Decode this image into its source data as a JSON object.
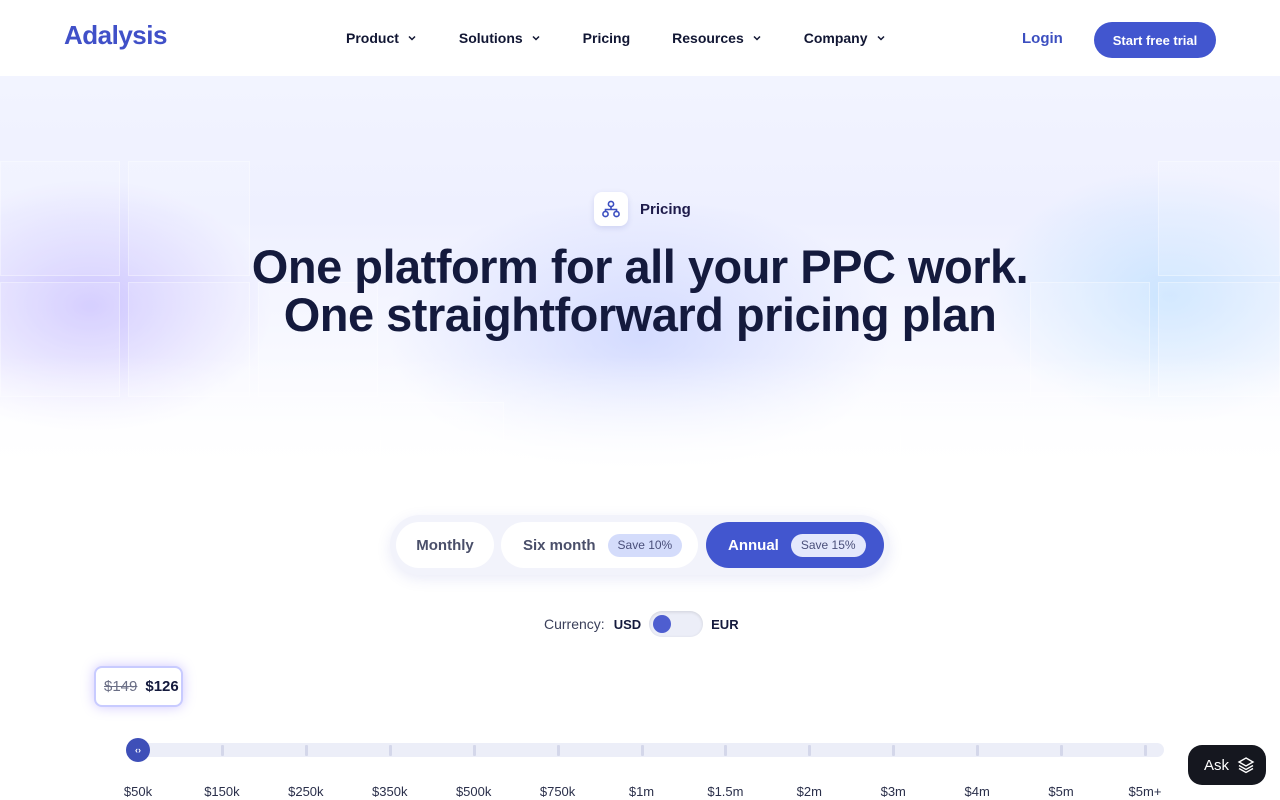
{
  "brand": {
    "name": "Adalysis",
    "color": "#4050c8"
  },
  "nav": {
    "items": [
      {
        "label": "Product",
        "has_dropdown": true
      },
      {
        "label": "Solutions",
        "has_dropdown": true
      },
      {
        "label": "Pricing",
        "has_dropdown": false
      },
      {
        "label": "Resources",
        "has_dropdown": true
      },
      {
        "label": "Company",
        "has_dropdown": true
      }
    ],
    "login_label": "Login",
    "cta_label": "Start free trial"
  },
  "hero": {
    "badge_label": "Pricing",
    "badge_icon": "sitemap-icon",
    "headline_line1": "One platform for all your PPC work.",
    "headline_line2": "One straightforward pricing plan"
  },
  "billing": {
    "options": [
      {
        "label": "Monthly",
        "save": ""
      },
      {
        "label": "Six month",
        "save": "Save 10%"
      },
      {
        "label": "Annual",
        "save": "Save 15%"
      }
    ],
    "selected": "Annual",
    "accent": "#4256cf"
  },
  "currency": {
    "label": "Currency:",
    "left": "USD",
    "right": "EUR",
    "selected": "USD"
  },
  "price": {
    "original": "$149",
    "discounted": "$126"
  },
  "spend_slider": {
    "ticks": [
      "$50k",
      "$150k",
      "$250k",
      "$350k",
      "$500k",
      "$750k",
      "$1m",
      "$1.5m",
      "$2m",
      "$3m",
      "$4m",
      "$5m",
      "$5m+"
    ],
    "selected_index": 0,
    "handle_icon": "code-arrows-icon"
  },
  "ask": {
    "label": "Ask",
    "icon": "layers-sparkle-icon"
  }
}
